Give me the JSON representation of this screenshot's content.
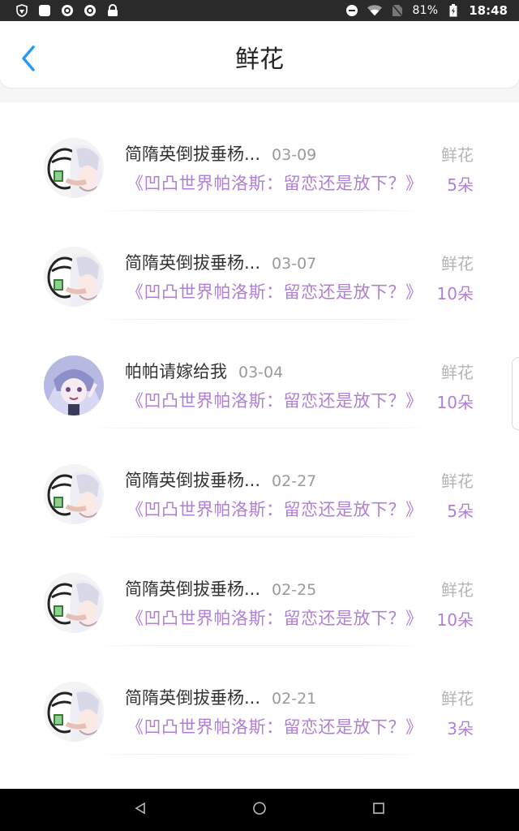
{
  "status_bar": {
    "battery": "81%",
    "time": "18:48",
    "icons_left": [
      "shield-icon",
      "square-icon",
      "sync-icon",
      "sync-icon",
      "lock-icon"
    ],
    "icons_right": [
      "do-not-disturb-icon",
      "wifi-icon",
      "no-sim-icon",
      "battery-icon"
    ]
  },
  "header": {
    "title": "鲜花",
    "back_icon": "chevron-left-icon",
    "accent": "#2a9bf0"
  },
  "colors": {
    "purple": "#b07fd6",
    "muted": "#b4b4b4"
  },
  "items": [
    {
      "name": "简隋英倒拔垂杨...",
      "date": "03-09",
      "type": "鲜花",
      "work": "《凹凸世界帕洛斯：留恋还是放下？》",
      "count": "5朵",
      "avatar": "meme-avatar"
    },
    {
      "name": "简隋英倒拔垂杨...",
      "date": "03-07",
      "type": "鲜花",
      "work": "《凹凸世界帕洛斯：留恋还是放下？》",
      "count": "10朵",
      "avatar": "meme-avatar"
    },
    {
      "name": "帕帕请嫁给我",
      "date": "03-04",
      "type": "鲜花",
      "work": "《凹凸世界帕洛斯：留恋还是放下？》",
      "count": "10朵",
      "avatar": "anime-avatar"
    },
    {
      "name": "简隋英倒拔垂杨...",
      "date": "02-27",
      "type": "鲜花",
      "work": "《凹凸世界帕洛斯：留恋还是放下？》",
      "count": "5朵",
      "avatar": "meme-avatar"
    },
    {
      "name": "简隋英倒拔垂杨...",
      "date": "02-25",
      "type": "鲜花",
      "work": "《凹凸世界帕洛斯：留恋还是放下？》",
      "count": "10朵",
      "avatar": "meme-avatar"
    },
    {
      "name": "简隋英倒拔垂杨...",
      "date": "02-21",
      "type": "鲜花",
      "work": "《凹凸世界帕洛斯：留恋还是放下？》",
      "count": "3朵",
      "avatar": "meme-avatar"
    }
  ],
  "nav_bar": {
    "back": "nav-back-icon",
    "home": "nav-home-icon",
    "recents": "nav-recents-icon"
  }
}
